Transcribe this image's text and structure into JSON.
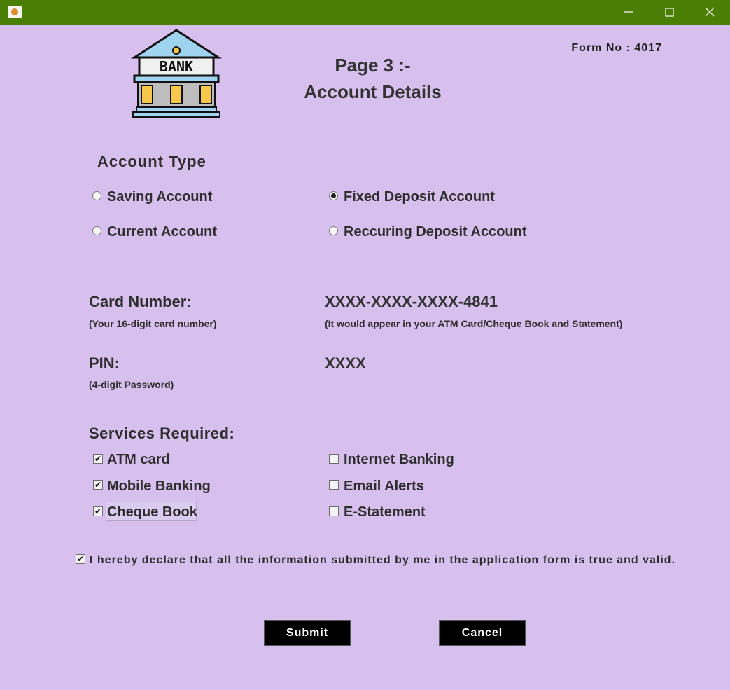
{
  "window": {
    "controls": [
      "minimize",
      "maximize",
      "close"
    ]
  },
  "header": {
    "form_no": "Form No : 4017",
    "title_line1": "Page 3 :-",
    "title_line2": "Account Details",
    "logo_text": "BANK"
  },
  "account_type": {
    "heading": "Account Type",
    "options": [
      {
        "label": "Saving Account",
        "selected": false
      },
      {
        "label": "Fixed Deposit Account",
        "selected": true
      },
      {
        "label": "Current Account",
        "selected": false
      },
      {
        "label": "Reccuring Deposit Account",
        "selected": false
      }
    ]
  },
  "card": {
    "label": "Card Number:",
    "hint": "(Your 16-digit card number)",
    "value": "XXXX-XXXX-XXXX-4841",
    "value_hint": "(It would appear in your ATM Card/Cheque Book and Statement)"
  },
  "pin": {
    "label": "PIN:",
    "hint": "(4-digit Password)",
    "value": "XXXX"
  },
  "services": {
    "heading": "Services Required:",
    "items": [
      {
        "label": "ATM card",
        "checked": true
      },
      {
        "label": "Internet Banking",
        "checked": false
      },
      {
        "label": "Mobile Banking",
        "checked": true
      },
      {
        "label": "Email Alerts",
        "checked": false
      },
      {
        "label": "Cheque Book",
        "checked": true
      },
      {
        "label": "E-Statement",
        "checked": false
      }
    ]
  },
  "declaration": {
    "text": "I hereby declare that all the information submitted by me in the application form is true and valid.",
    "checked": true
  },
  "buttons": {
    "submit": "Submit",
    "cancel": "Cancel"
  },
  "colors": {
    "titlebar": "#4a7e04",
    "background": "#d8c0ee",
    "button": "#000000"
  }
}
